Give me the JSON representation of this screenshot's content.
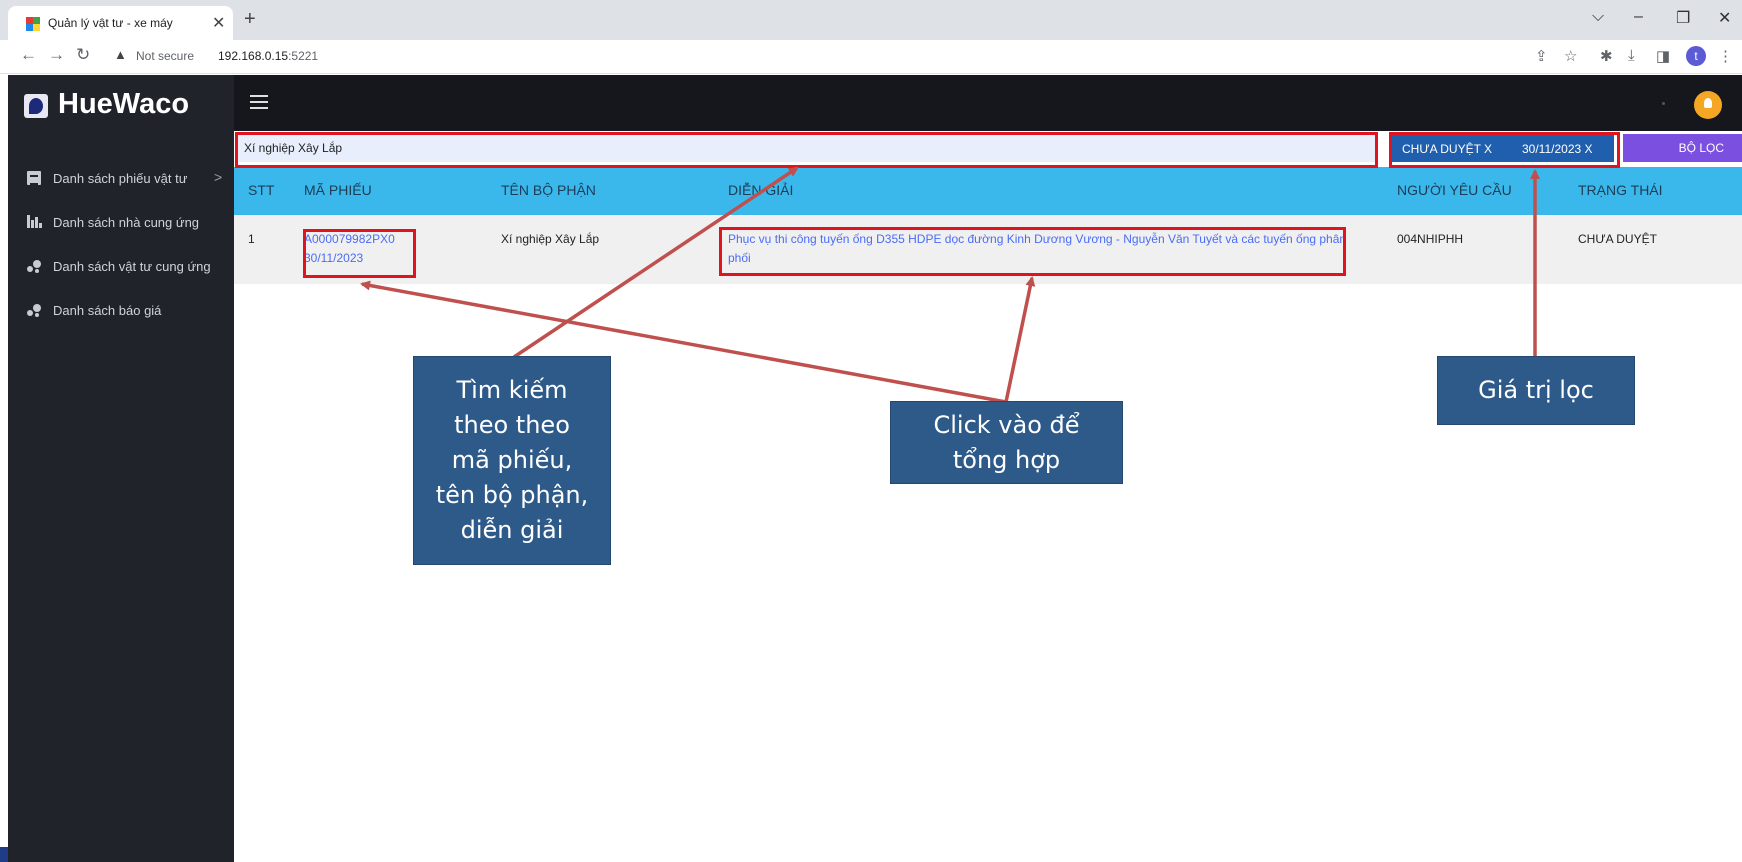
{
  "browser": {
    "tab_title": "Quản lý vật tư - xe máy",
    "tab_close": "✕",
    "new_tab": "+",
    "not_secure": "Not secure",
    "url_host": "192.168.0.15",
    "url_port": ":5221",
    "profile_initial": "t"
  },
  "app": {
    "logo_text": "HueWaco"
  },
  "sidebar": {
    "items": [
      {
        "label": "Danh sách phiếu vật tư",
        "icon": "list-icon",
        "has_chevron": true
      },
      {
        "label": "Danh sách nhà cung ứng",
        "icon": "bar-chart-icon"
      },
      {
        "label": "Danh sách vật tư cung ứng",
        "icon": "dots-icon"
      },
      {
        "label": "Danh sách báo giá",
        "icon": "dots-icon"
      }
    ],
    "chevron": ">"
  },
  "filter": {
    "search_value": "Xí nghiệp Xây Lắp",
    "chip_status": "CHƯA DUYỆT X",
    "chip_date": "30/11/2023 X",
    "filter_button": "BỘ LỌC"
  },
  "table": {
    "headers": [
      "STT",
      "MÃ PHIẾU",
      "TÊN BỘ PHẬN",
      "DIỄN GIẢI",
      "NGƯỜI YÊU CẦU",
      "TRẠNG THÁI"
    ],
    "rows": [
      {
        "stt": "1",
        "ma_phieu_line1": "A000079982PX0",
        "ma_phieu_line2": "30/11/2023",
        "ten_bo_phan": "Xí nghiệp Xây Lắp",
        "dien_giai": "Phục vụ thi công tuyến ống D355 HDPE dọc đường Kinh Dương Vương - Nguyễn Văn Tuyết và các tuyến ống phân phối",
        "nguoi_yeu_cau": "004NHIPHH",
        "trang_thai": "CHƯA DUYỆT"
      }
    ]
  },
  "annotations": {
    "search_note": [
      "Tìm kiếm",
      "theo theo",
      "mã phiếu,",
      "tên bộ phận,",
      "diễn giải"
    ],
    "click_note": [
      "Click vào để",
      "tổng hợp"
    ],
    "filter_note": [
      "Giá trị lọc"
    ]
  },
  "colors": {
    "sidebar_bg": "#20232a",
    "header_bg": "#3ab8ec",
    "filter_chip_bg": "#1f5fae",
    "filter_button_bg": "#7b4fe0",
    "annotation_red": "#e0141e",
    "callout_bg": "#2e5a8a",
    "link": "#4a6cf7"
  }
}
